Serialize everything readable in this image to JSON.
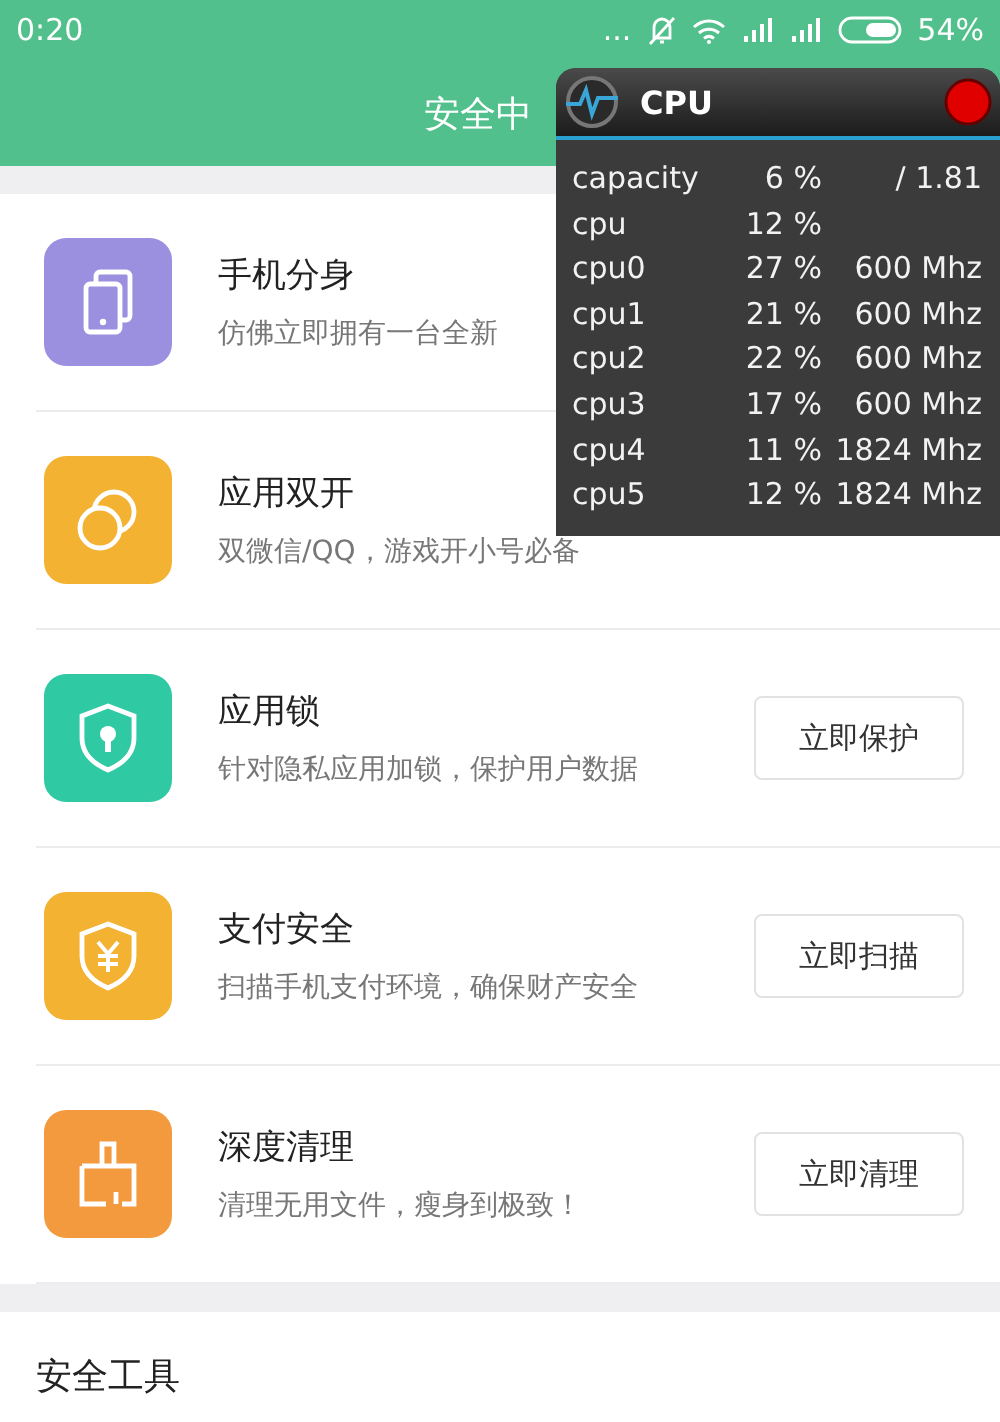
{
  "status_bar": {
    "time": "0:20",
    "more": "...",
    "battery": "54%"
  },
  "header": {
    "title": "安全中"
  },
  "features": [
    {
      "kind": "phones",
      "color": "#9b8fe0",
      "title": "手机分身",
      "description": "仿佛立即拥有一台全新"
    },
    {
      "kind": "circles",
      "color": "#f3b232",
      "title": "应用双开",
      "description": "双微信/QQ，游戏开小号必备"
    },
    {
      "kind": "lock",
      "color": "#2fc9a4",
      "title": "应用锁",
      "description": "针对隐私应用加锁，保护用户数据",
      "button": "立即保护"
    },
    {
      "kind": "yen",
      "color": "#f3b232",
      "title": "支付安全",
      "description": "扫描手机支付环境，确保财产安全",
      "button": "立即扫描"
    },
    {
      "kind": "brush",
      "color": "#f39a3e",
      "title": "深度清理",
      "description": "清理无用文件，瘦身到极致！",
      "button": "立即清理"
    }
  ],
  "section": {
    "title": "安全工具"
  },
  "cpu_overlay": {
    "title": "CPU",
    "rows": [
      {
        "name": "capacity",
        "percent": "6 %",
        "value": "/ 1.81"
      },
      {
        "name": "cpu",
        "percent": "12 %"
      },
      {
        "name": "cpu0",
        "percent": "27 %",
        "value": "600 Mhz"
      },
      {
        "name": "cpu1",
        "percent": "21 %",
        "value": "600 Mhz"
      },
      {
        "name": "cpu2",
        "percent": "22 %",
        "value": "600 Mhz"
      },
      {
        "name": "cpu3",
        "percent": "17 %",
        "value": "600 Mhz"
      },
      {
        "name": "cpu4",
        "percent": "11 %",
        "value": "1824 Mhz"
      },
      {
        "name": "cpu5",
        "percent": "12 %",
        "value": "1824 Mhz"
      }
    ]
  }
}
